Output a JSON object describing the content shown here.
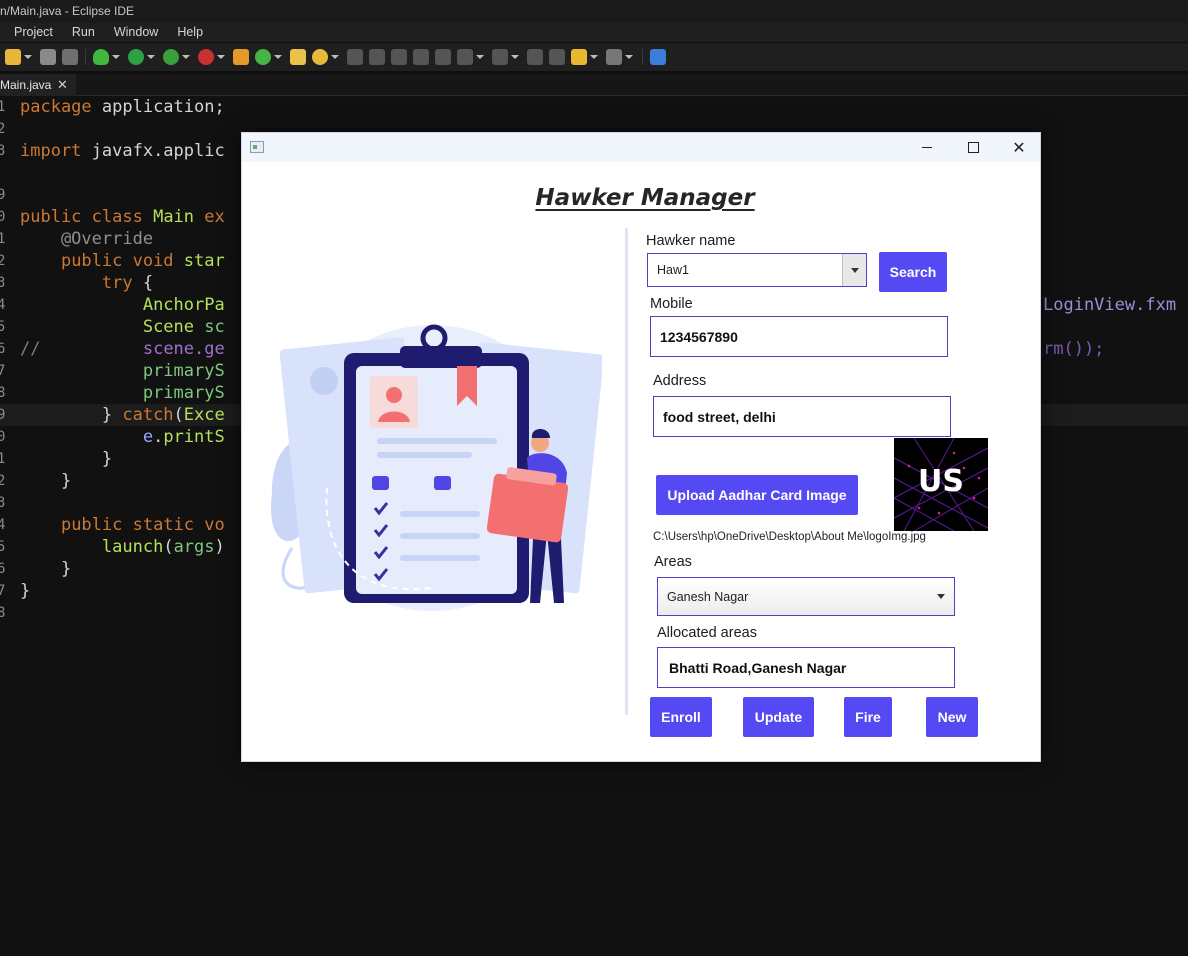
{
  "eclipse": {
    "title": "n/Main.java - Eclipse IDE",
    "menu": [
      "Project",
      "Run",
      "Window",
      "Help"
    ],
    "editor_tab": "Main.java",
    "code_lines": [
      {
        "no": "1",
        "text": "package application;"
      },
      {
        "no": "2",
        "text": ""
      },
      {
        "no": "3",
        "text": "import javafx.applic"
      },
      {
        "no": "9",
        "text": ""
      },
      {
        "no": "0",
        "text": "public class Main ex"
      },
      {
        "no": "1",
        "text": "    @Override"
      },
      {
        "no": "2",
        "text": "    public void star"
      },
      {
        "no": "3",
        "text": "        try {"
      },
      {
        "no": "4",
        "text": "            AnchorPa"
      },
      {
        "no": "5",
        "text": "            Scene sc"
      },
      {
        "no": "6",
        "text": "//          scene.ge"
      },
      {
        "no": "7",
        "text": "            primaryS"
      },
      {
        "no": "8",
        "text": "            primaryS"
      },
      {
        "no": "9",
        "text": "        } catch(Exce"
      },
      {
        "no": "0",
        "text": "            e.printS"
      },
      {
        "no": "1",
        "text": "        }"
      },
      {
        "no": "2",
        "text": "    }"
      },
      {
        "no": "3",
        "text": ""
      },
      {
        "no": "4",
        "text": "    public static vo"
      },
      {
        "no": "5",
        "text": "        launch(args)"
      },
      {
        "no": "6",
        "text": "    }"
      },
      {
        "no": "7",
        "text": "}"
      },
      {
        "no": "8",
        "text": ""
      }
    ],
    "code_right_1": "LoginView.fxm",
    "code_right_2": "rm());"
  },
  "app": {
    "heading": "Hawker Manager",
    "hawker_name_label": "Hawker name",
    "hawker_name_value": "Haw1",
    "search_label": "Search",
    "mobile_label": "Mobile",
    "mobile_value": "1234567890",
    "address_label": "Address",
    "address_value": "food street, delhi",
    "upload_label": "Upload Aadhar Card Image",
    "image_path": "C:\\Users\\hp\\OneDrive\\Desktop\\About Me\\logoImg.jpg",
    "preview_text": "US",
    "areas_label": "Areas",
    "areas_value": "Ganesh Nagar",
    "allocated_label": "Allocated areas",
    "allocated_value": "Bhatti Road,Ganesh Nagar",
    "buttons": {
      "enroll": "Enroll",
      "update": "Update",
      "fire": "Fire",
      "new": "New"
    },
    "colors": {
      "accent": "#5549f3",
      "field_border": "#4a42c8"
    }
  }
}
